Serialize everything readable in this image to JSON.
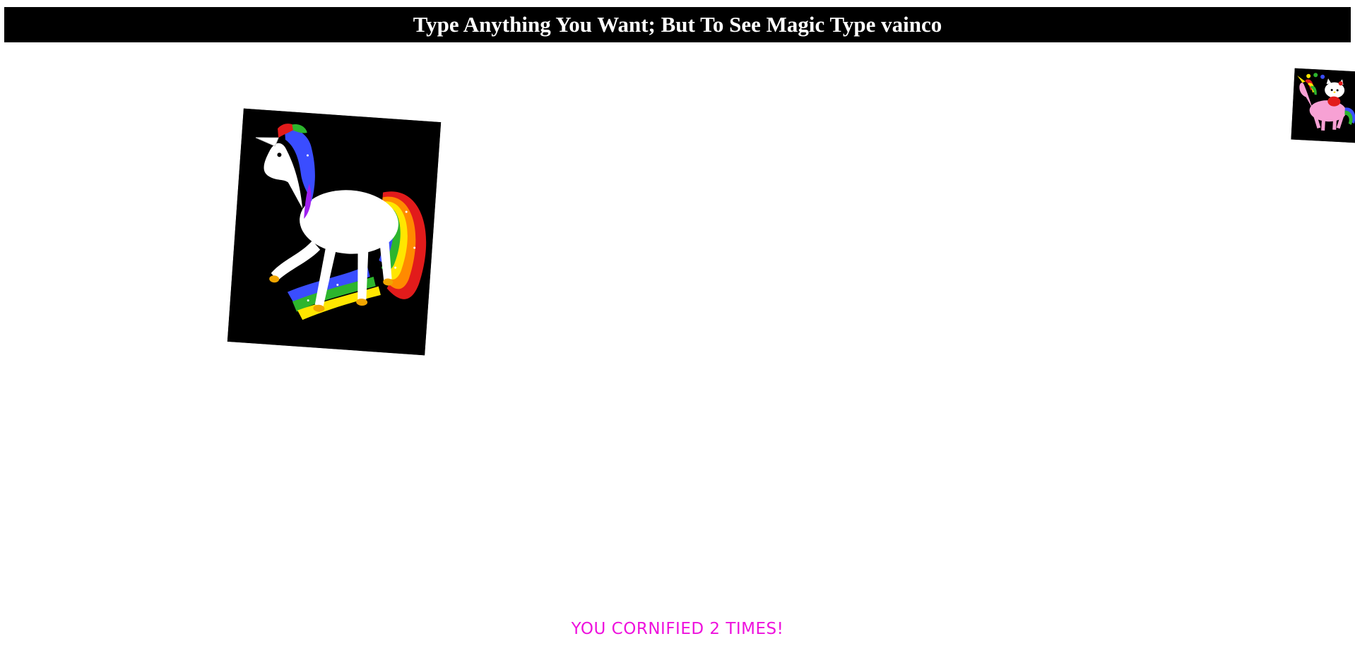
{
  "banner": {
    "text": "Type Anything You Want; But To See Magic Type vainco",
    "background": "#000000",
    "color": "#ffffff"
  },
  "images": {
    "main": {
      "icon": "rainbow-unicorn-icon",
      "background": "#000000"
    },
    "corner": {
      "icon": "hello-kitty-unicorn-icon",
      "background": "#000000"
    }
  },
  "counter": {
    "text": "YOU CORNIFIED 2 TIMES!",
    "color": "#ee11dd"
  }
}
